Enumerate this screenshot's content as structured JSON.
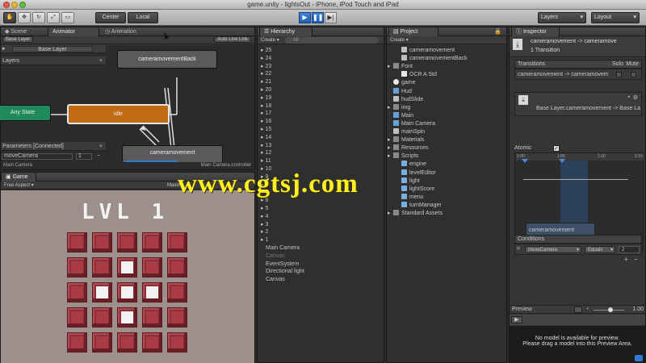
{
  "window": {
    "title": "game.unity - lightsOut - iPhone, iPod Touch and iPad"
  },
  "toolbar": {
    "center_label": "Center",
    "local_label": "Local",
    "layers_label": "Layers",
    "layout_label": "Layout",
    "play_icon": "play-icon",
    "pause_icon": "pause-icon",
    "step_icon": "step-icon"
  },
  "scene_tabs": [
    {
      "label": "Scene"
    },
    {
      "label": "Animator"
    },
    {
      "label": "Animation"
    }
  ],
  "animator": {
    "base_layer_breadcrumb": "Base Layer",
    "auto_live_link": "Auto Live Link",
    "base_layer_label": "Base Layer",
    "layers_label": "Layers",
    "parameters_label": "Parameters [Connected]",
    "param_name": "moveCamera",
    "param_value": "1",
    "nodes": {
      "any_state": "Any State",
      "idle": "idle",
      "camera_back": "cameramovementBack",
      "camera": "cameramovement"
    },
    "footer_left": "Main Camera",
    "footer_right": "Main Camera.controller"
  },
  "game": {
    "tab_label": "Game",
    "aspect_label": "Free Aspect",
    "maximize_label": "Maximi",
    "level_title": "LVL 1",
    "lit_cells": [
      [
        1,
        2
      ],
      [
        2,
        1
      ],
      [
        2,
        2
      ],
      [
        2,
        3
      ],
      [
        3,
        2
      ]
    ]
  },
  "hierarchy": {
    "tab_label": "Hierarchy",
    "create_label": "Create",
    "search_placeholder": "All",
    "numbered_items": [
      "25",
      "24",
      "23",
      "22",
      "21",
      "20",
      "19",
      "18",
      "17",
      "16",
      "15",
      "14",
      "13",
      "12",
      "11",
      "10",
      "9",
      "8",
      "7",
      "6",
      "5",
      "4",
      "3",
      "2",
      "1"
    ],
    "items": [
      {
        "label": "Main Camera",
        "dim": false
      },
      {
        "label": "Canvas",
        "dim": true
      },
      {
        "label": "EventSystem",
        "dim": false
      },
      {
        "label": "Directional light",
        "dim": false
      },
      {
        "label": "Canvas",
        "dim": false
      }
    ]
  },
  "project": {
    "tab_label": "Project",
    "create_label": "Create",
    "items": [
      {
        "label": "cameramovement",
        "indent": 1,
        "icon": "anim-icon"
      },
      {
        "label": "cameramovementBack",
        "indent": 1,
        "icon": "anim-icon"
      },
      {
        "label": "Font",
        "indent": 0,
        "icon": "folder-icon"
      },
      {
        "label": "OCR A Std",
        "indent": 1,
        "icon": "font-icon"
      },
      {
        "label": "game",
        "indent": 0,
        "icon": "unity-icon"
      },
      {
        "label": "Hud",
        "indent": 0,
        "icon": "prefab-icon"
      },
      {
        "label": "hudSlide",
        "indent": 0,
        "icon": "anim-icon"
      },
      {
        "label": "img",
        "indent": 0,
        "icon": "folder-icon"
      },
      {
        "label": "Main",
        "indent": 0,
        "icon": "prefab-icon"
      },
      {
        "label": "Main Camera",
        "indent": 0,
        "icon": "prefab-icon"
      },
      {
        "label": "mainSpin",
        "indent": 0,
        "icon": "anim-icon"
      },
      {
        "label": "Materials",
        "indent": 0,
        "icon": "folder-icon"
      },
      {
        "label": "Resources",
        "indent": 0,
        "icon": "folder-icon"
      },
      {
        "label": "Scripts",
        "indent": 0,
        "icon": "folder-icon"
      },
      {
        "label": "engine",
        "indent": 1,
        "icon": "script-icon"
      },
      {
        "label": "levelEditor",
        "indent": 1,
        "icon": "script-icon"
      },
      {
        "label": "light",
        "indent": 1,
        "icon": "script-icon"
      },
      {
        "label": "lightScore",
        "indent": 1,
        "icon": "script-icon"
      },
      {
        "label": "menu",
        "indent": 1,
        "icon": "script-icon"
      },
      {
        "label": "turnManager",
        "indent": 1,
        "icon": "script-icon"
      },
      {
        "label": "Standard Assets",
        "indent": 0,
        "icon": "folder-icon"
      }
    ]
  },
  "inspector": {
    "tab_label": "Inspector",
    "transition_title": "cameramovement -> cameramove",
    "transition_count": "1 Transition",
    "transitions_header": "Transitions",
    "solo_label": "Solo",
    "mute_label": "Mute",
    "transition_row": "cameramovement -> cameramovem",
    "base_layer_path": "Base Layer.cameramovement -> Base La",
    "atomic_label": "Atomic",
    "timeline_ticks": [
      "1:00",
      "1:05",
      "1:10",
      "1:15"
    ],
    "timeline_clip_a": "cameramovement",
    "timeline_clip_b": "cameramovementBack",
    "conditions_header": "Conditions",
    "condition_param": "moveCamera",
    "condition_op": "Equals",
    "condition_value": "2",
    "preview_label": "Preview",
    "preview_speed": "1.00",
    "preview_msg_1": "No model is available for preview.",
    "preview_msg_2": "Please drag a model into this Preview Area."
  },
  "watermark": {
    "text": "www.cgtsj.com"
  },
  "colors": {
    "accent_blue": "#2f7ad0",
    "idle_orange": "#c06a14",
    "anystate_green": "#1f8a5a",
    "tile_red": "#8b2f38",
    "watermark_yellow": "#ffee22"
  }
}
